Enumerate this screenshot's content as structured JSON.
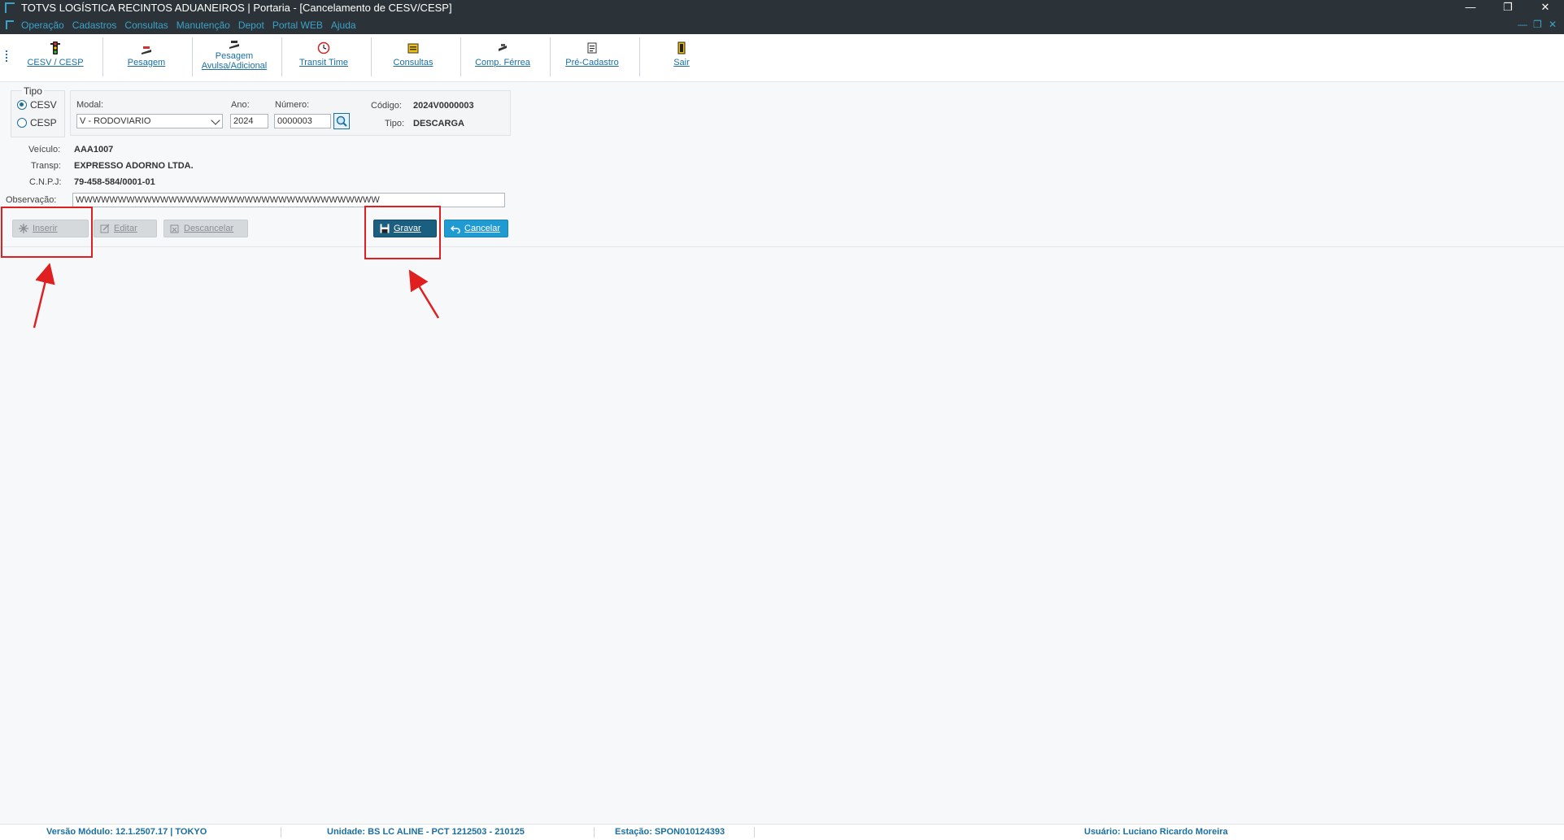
{
  "window": {
    "title": "TOTVS LOGÍSTICA RECINTOS ADUANEIROS | Portaria - [Cancelamento de CESV/CESP]",
    "minimize": "—",
    "restore": "❐",
    "close": "✕"
  },
  "menu": {
    "items": [
      "Operação",
      "Cadastros",
      "Consultas",
      "Manutenção",
      "Depot",
      "Portal WEB",
      "Ajuda"
    ],
    "mdi_minimize": "—",
    "mdi_restore": "❐",
    "mdi_close": "✕"
  },
  "toolbar": {
    "items": [
      {
        "label": "CESV / CESP",
        "icon": "traffic-light-icon"
      },
      {
        "label": "Pesagem",
        "icon": "scale-icon"
      },
      {
        "label": "Pesagem Avulsa/Adicional",
        "label_line1": "Pesagem",
        "label_line2": "Avulsa/Adicional",
        "icon": "scale-icon"
      },
      {
        "label": "Transit Time",
        "icon": "clock-icon"
      },
      {
        "label": "Consultas",
        "icon": "consult-icon"
      },
      {
        "label": "Comp. Férrea",
        "icon": "train-icon"
      },
      {
        "label": "Pré-Cadastro",
        "icon": "document-icon"
      },
      {
        "label": "Sair",
        "icon": "exit-door-icon"
      }
    ]
  },
  "form": {
    "tipo": {
      "legend": "Tipo",
      "options": [
        "CESV",
        "CESP"
      ],
      "selected": "CESV"
    },
    "modal_label": "Modal:",
    "modal_value": "V - RODOVIARIO",
    "ano_label": "Ano:",
    "ano_value": "2024",
    "numero_label": "Número:",
    "numero_value": "0000003",
    "codigo_label": "Código:",
    "codigo_value": "2024V0000003",
    "tipo_label": "Tipo:",
    "tipo_value": "DESCARGA",
    "veiculo_label": "Veículo:",
    "veiculo_value": "AAA1007",
    "transp_label": "Transp:",
    "transp_value": "EXPRESSO ADORNO LTDA.",
    "cnpj_label": "C.N.P.J:",
    "cnpj_value": "79-458-584/0001-01",
    "observacao_label": "Observação:",
    "observacao_value": "WWWWWWWWWWWWWWWWWWWWWWWWWWWWWWWWWWWW"
  },
  "actions": {
    "inserir": "Inserir",
    "editar": "Editar",
    "descancelar": "Descancelar",
    "gravar": "Gravar",
    "cancelar": "Cancelar"
  },
  "status": {
    "versao": "Versão Módulo:  12.1.2507.17  |  TOKYO",
    "unidade": "Unidade: BS LC ALINE - PCT 1212503 - 210125",
    "estacao": "Estação: SPON010124393",
    "usuario": "Usuário: Luciano Ricardo Moreira"
  },
  "colors": {
    "accent": "#1b6fa0",
    "titlebar": "#2b3338",
    "highlight_annotation": "#e02020"
  }
}
